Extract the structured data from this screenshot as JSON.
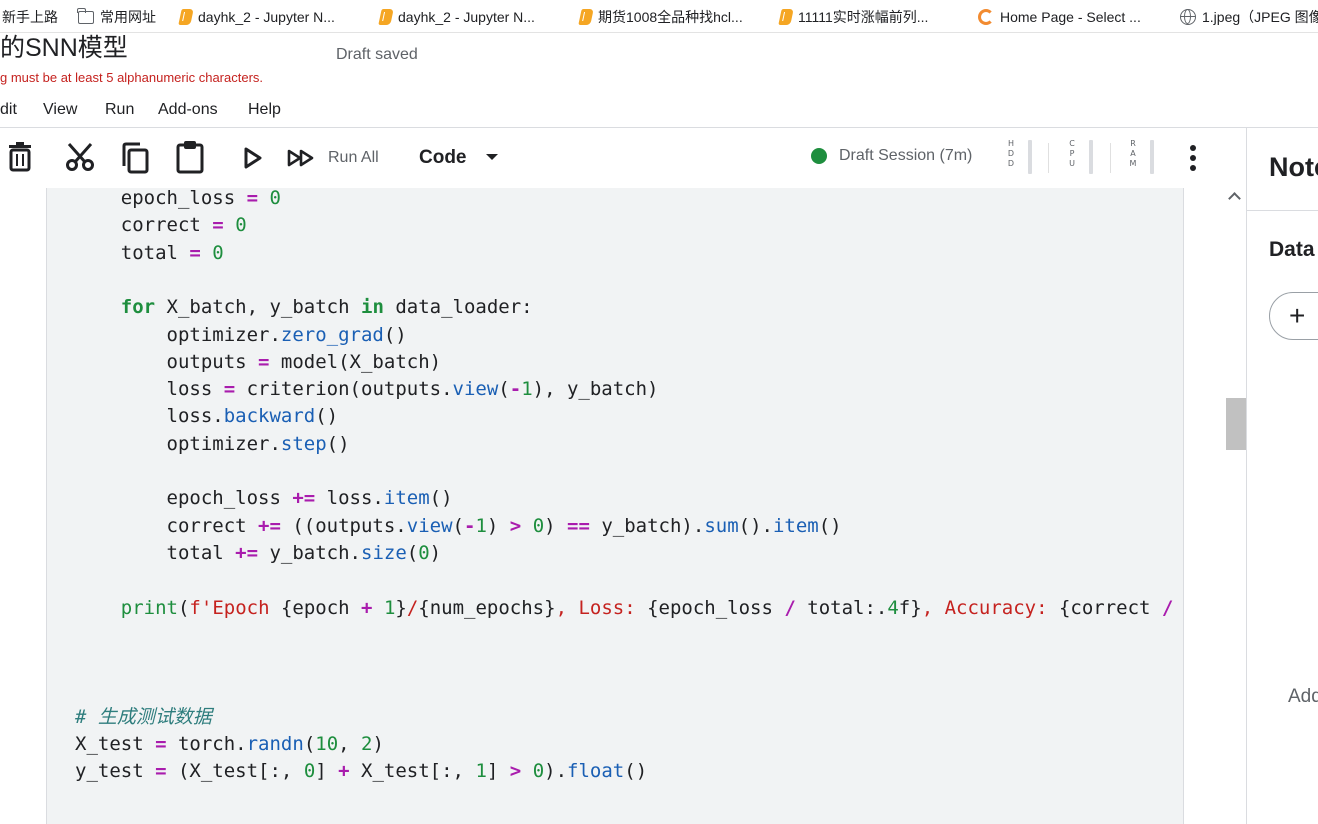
{
  "bookmarks": [
    {
      "label": "新手上路",
      "icon": "none"
    },
    {
      "label": "常用网址",
      "icon": "folder-icon"
    },
    {
      "label": "dayhk_2 - Jupyter N...",
      "icon": "jupyter-icon"
    },
    {
      "label": "dayhk_2 - Jupyter N...",
      "icon": "jupyter-icon"
    },
    {
      "label": "期货1008全品种找hcl...",
      "icon": "jupyter-icon"
    },
    {
      "label": "11111实时涨幅前列...",
      "icon": "jupyter-icon"
    },
    {
      "label": "Home Page - Select ...",
      "icon": "loading-ring-icon"
    },
    {
      "label": "1.jpeg（JPEG 图像",
      "icon": "globe-icon"
    }
  ],
  "header": {
    "title": "的SNN模型",
    "draft_status": "Draft saved",
    "error": "g must be at least 5 alphanumeric characters."
  },
  "menu": [
    "dit",
    "View",
    "Run",
    "Add-ons",
    "Help"
  ],
  "toolbar": {
    "run_all_label": "Run All",
    "cell_type": "Code",
    "session": "Draft Session (7m)",
    "gauges": [
      "HDD",
      "CPU",
      "RAM"
    ],
    "icons": [
      "delete-icon",
      "cut-icon",
      "copy-icon",
      "paste-icon",
      "run-icon",
      "run-all-icon",
      "chevron-down-icon",
      "more-vert-icon"
    ]
  },
  "code_lines": [
    "    epoch_loss = 0",
    "    correct = 0",
    "    total = 0",
    "",
    "    for X_batch, y_batch in data_loader:",
    "        optimizer.zero_grad()",
    "        outputs = model(X_batch)",
    "        loss = criterion(outputs.view(-1), y_batch)",
    "        loss.backward()",
    "        optimizer.step()",
    "",
    "        epoch_loss += loss.item()",
    "        correct += ((outputs.view(-1) > 0) == y_batch).sum().item()",
    "        total += y_batch.size(0)",
    "",
    "    print(f'Epoch {epoch + 1}/{num_epochs}, Loss: {epoch_loss / total:.4f}, Accuracy: {correct /",
    "",
    "",
    "",
    "# 生成测试数据",
    "X_test = torch.randn(10, 2)",
    "y_test = (X_test[:, 0] + X_test[:, 1] > 0).float()"
  ],
  "side_panel": {
    "title": "Notebook",
    "section": "Data",
    "add_icon": "+",
    "add_text": "Add"
  },
  "colors": {
    "keyword": "#1e8e3e",
    "operator": "#a91cad",
    "function": "#1a5fb4",
    "string": "#c5221f",
    "comment": "#2e7d7d",
    "session_dot": "#1e8e3e",
    "error": "#c5221f"
  }
}
